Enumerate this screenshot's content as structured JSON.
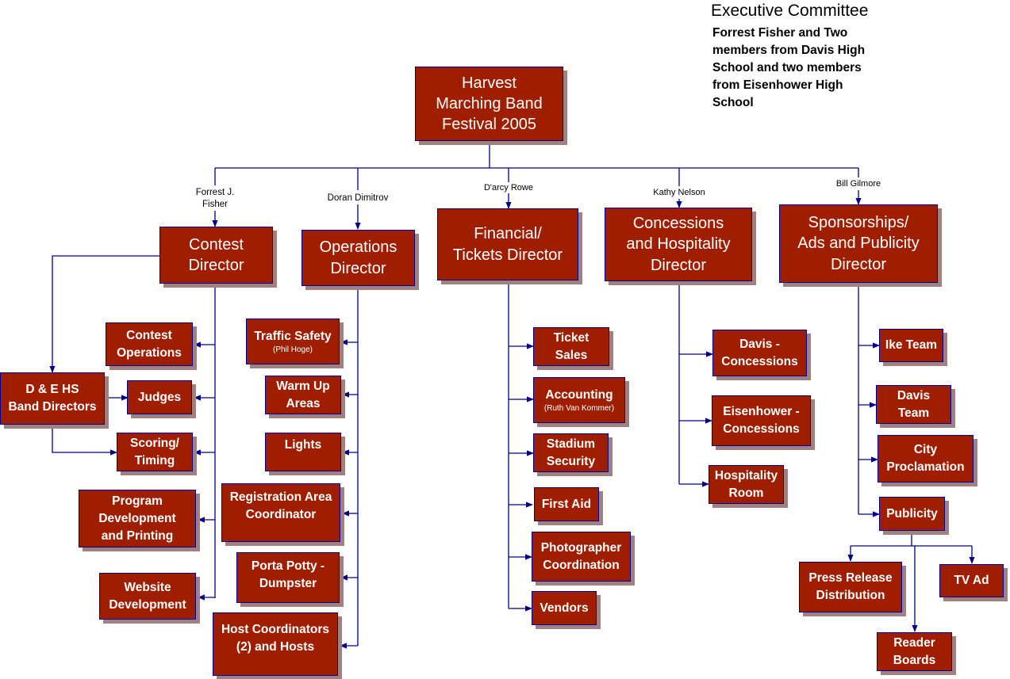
{
  "colors": {
    "box_fill": "#a01e00",
    "box_border": "#00008b",
    "box_shadow": "#a08080",
    "box_text": "#ffffff",
    "connector": "#00008b"
  },
  "executive_committee": {
    "title": "Executive Committee",
    "body": "Forrest Fisher and Two\nmembers from Davis High\nSchool and two members\nfrom Eisenhower High\nSchool"
  },
  "root": {
    "title": "Harvest\nMarching Band\nFestival 2005"
  },
  "directors": [
    {
      "id": "contest",
      "title": "Contest\nDirector",
      "person": "Forrest J.\nFisher"
    },
    {
      "id": "operations",
      "title": "Operations\nDirector",
      "person": "Doran Dimitrov"
    },
    {
      "id": "financial",
      "title": "Financial/\nTickets Director",
      "person": "D'arcy Rowe"
    },
    {
      "id": "concessions",
      "title": "Concessions\nand Hospitality\nDirector",
      "person": "Kathy Nelson"
    },
    {
      "id": "sponsorships",
      "title": "Sponsorships/\nAds and Publicity\nDirector",
      "person": "Bill Gilmore"
    }
  ],
  "contest_units": [
    {
      "title": "Contest\nOperations"
    },
    {
      "title": "D & E HS\nBand Directors"
    },
    {
      "title": "Judges"
    },
    {
      "title": "Scoring/\nTiming"
    },
    {
      "title": "Program\nDevelopment\nand Printing"
    },
    {
      "title": "Website\nDevelopment"
    }
  ],
  "operations_units": [
    {
      "title": "Traffic Safety",
      "note": "(Phil Hoge)"
    },
    {
      "title": "Warm Up\nAreas"
    },
    {
      "title": "Lights"
    },
    {
      "title": "Registration Area\nCoordinator"
    },
    {
      "title": "Porta Potty -\nDumpster"
    },
    {
      "title": "Host Coordinators\n(2) and Hosts"
    }
  ],
  "financial_units": [
    {
      "title": "Ticket\nSales"
    },
    {
      "title": "Accounting",
      "note": "(Ruth Van Kommer)"
    },
    {
      "title": "Stadium\nSecurity"
    },
    {
      "title": "First Aid"
    },
    {
      "title": "Photographer\nCoordination"
    },
    {
      "title": "Vendors"
    }
  ],
  "concessions_units": [
    {
      "title": "Davis -\nConcessions"
    },
    {
      "title": "Eisenhower -\nConcessions"
    },
    {
      "title": "Hospitality\nRoom"
    }
  ],
  "sponsorship_units": [
    {
      "title": "Ike Team"
    },
    {
      "title": "Davis\nTeam"
    },
    {
      "title": "City\nProclamation"
    },
    {
      "title": "Publicity"
    }
  ],
  "publicity_units": [
    {
      "title": "Press Release\nDistribution"
    },
    {
      "title": "Reader\nBoards"
    },
    {
      "title": "TV Ad"
    }
  ]
}
